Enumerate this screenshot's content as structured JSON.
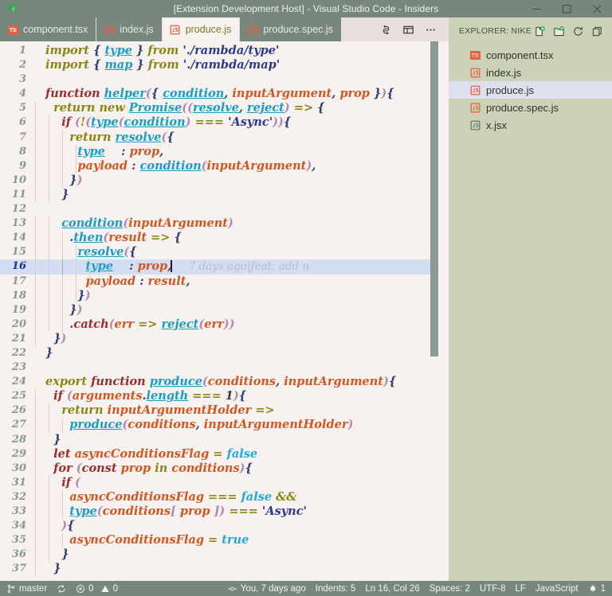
{
  "window": {
    "title": "[Extension Development Host] - Visual Studio Code - Insiders",
    "logo_icon": "vscode-insiders-logo",
    "controls": [
      {
        "name": "minimize-button",
        "icon": "minimize-icon"
      },
      {
        "name": "maximize-button",
        "icon": "maximize-icon"
      },
      {
        "name": "close-button",
        "icon": "close-icon"
      }
    ]
  },
  "tabs": [
    {
      "label": "component.tsx",
      "icon": "typescript-react-file-icon",
      "active": false
    },
    {
      "label": "index.js",
      "icon": "javascript-file-icon",
      "active": false
    },
    {
      "label": "produce.js",
      "icon": "javascript-file-icon",
      "active": true
    },
    {
      "label": "produce.spec.js",
      "icon": "javascript-file-icon",
      "active": false
    }
  ],
  "tab_actions": [
    {
      "name": "split-editor-vertical-button",
      "icon": "split-editor-icon"
    },
    {
      "name": "toggle-layout-button",
      "icon": "panel-layout-icon"
    },
    {
      "name": "more-actions-button",
      "icon": "ellipsis-icon"
    }
  ],
  "explorer": {
    "title": "EXPLORER: NIKE...",
    "actions": [
      {
        "name": "new-file-button",
        "icon": "new-file-icon"
      },
      {
        "name": "new-folder-button",
        "icon": "new-folder-icon"
      },
      {
        "name": "refresh-explorer-button",
        "icon": "refresh-icon"
      },
      {
        "name": "collapse-folders-button",
        "icon": "collapse-all-icon"
      }
    ],
    "files": [
      {
        "label": "component.tsx",
        "icon": "typescript-react-file-icon",
        "selected": false
      },
      {
        "label": "index.js",
        "icon": "javascript-file-icon",
        "selected": false
      },
      {
        "label": "produce.js",
        "icon": "javascript-file-icon",
        "selected": true
      },
      {
        "label": "produce.spec.js",
        "icon": "javascript-file-icon",
        "selected": false
      },
      {
        "label": "x.jsx",
        "icon": "javascript-react-file-icon",
        "selected": false
      }
    ]
  },
  "editor": {
    "active_line": 16,
    "cursor_line_blame": "7 days ago|feat: add n",
    "first_line": 1,
    "last_line": 37,
    "lines": [
      {
        "n": "1",
        "text": "import { type } from './rambda/type'"
      },
      {
        "n": "2",
        "text": "import { map } from './rambda/map'"
      },
      {
        "n": "3",
        "text": ""
      },
      {
        "n": "4",
        "text": "function helper({ condition, inputArgument, prop }){"
      },
      {
        "n": "5",
        "text": "  return new Promise((resolve, reject) => {"
      },
      {
        "n": "6",
        "text": "    if (!(type(condition) === 'Async')){"
      },
      {
        "n": "7",
        "text": "      return resolve({"
      },
      {
        "n": "8",
        "text": "        type    : prop,"
      },
      {
        "n": "9",
        "text": "        payload : condition(inputArgument),"
      },
      {
        "n": "10",
        "text": "      })"
      },
      {
        "n": "11",
        "text": "    }"
      },
      {
        "n": "12",
        "text": ""
      },
      {
        "n": "13",
        "text": "    condition(inputArgument)"
      },
      {
        "n": "14",
        "text": "      .then(result => {"
      },
      {
        "n": "15",
        "text": "        resolve({"
      },
      {
        "n": "16",
        "text": "          type    : prop,"
      },
      {
        "n": "17",
        "text": "          payload : result,"
      },
      {
        "n": "18",
        "text": "        })"
      },
      {
        "n": "19",
        "text": "      })"
      },
      {
        "n": "20",
        "text": "      .catch(err => reject(err))"
      },
      {
        "n": "21",
        "text": "  })"
      },
      {
        "n": "22",
        "text": "}"
      },
      {
        "n": "23",
        "text": ""
      },
      {
        "n": "24",
        "text": "export function produce(conditions, inputArgument){"
      },
      {
        "n": "25",
        "text": "  if (arguments.length === 1){"
      },
      {
        "n": "26",
        "text": "    return inputArgumentHolder =>"
      },
      {
        "n": "27",
        "text": "      produce(conditions, inputArgumentHolder)"
      },
      {
        "n": "28",
        "text": "  }"
      },
      {
        "n": "29",
        "text": "  let asyncConditionsFlag = false"
      },
      {
        "n": "30",
        "text": "  for (const prop in conditions){"
      },
      {
        "n": "31",
        "text": "    if ("
      },
      {
        "n": "32",
        "text": "      asyncConditionsFlag === false &&"
      },
      {
        "n": "33",
        "text": "      type(conditions[ prop ]) === 'Async'"
      },
      {
        "n": "34",
        "text": "    ){"
      },
      {
        "n": "35",
        "text": "      asyncConditionsFlag = true"
      },
      {
        "n": "36",
        "text": "    }"
      },
      {
        "n": "37",
        "text": "  }"
      }
    ]
  },
  "statusbar": {
    "left": [
      {
        "name": "source-control-branch",
        "icon": "git-branch-icon",
        "label": "master"
      },
      {
        "name": "sync-changes-button",
        "icon": "sync-icon",
        "label": ""
      },
      {
        "name": "problems-indicator",
        "icon": "error-warning-icon",
        "label": "0  0",
        "errors": "0",
        "warnings": "0"
      }
    ],
    "right": [
      {
        "name": "git-blame-status",
        "icon": "git-commit-icon",
        "label": "You, 7 days ago"
      },
      {
        "name": "indents-status",
        "label": "Indents: 5"
      },
      {
        "name": "cursor-position-status",
        "label": "Ln 16, Col 26"
      },
      {
        "name": "indentation-status",
        "label": "Spaces: 2"
      },
      {
        "name": "encoding-status",
        "label": "UTF-8"
      },
      {
        "name": "eol-status",
        "label": "LF"
      },
      {
        "name": "language-mode-status",
        "label": "JavaScript"
      },
      {
        "name": "notifications-status",
        "icon": "bell-icon",
        "label": "1"
      }
    ]
  },
  "colors": {
    "chrome": "#78877d",
    "sidebar": "#ccd2b7",
    "editor_bg": "#f7f2f0",
    "tabbar_bg": "#e8dfdd",
    "active_tab_fg": "#7c7a18",
    "active_line": "#d5ddf2",
    "selection": "#dde0ef",
    "accent_orange": "#d2561e",
    "accent_teal": "#1b9cc4",
    "keyword_olive": "#8a8612",
    "string_blue": "#2b3a8f"
  }
}
